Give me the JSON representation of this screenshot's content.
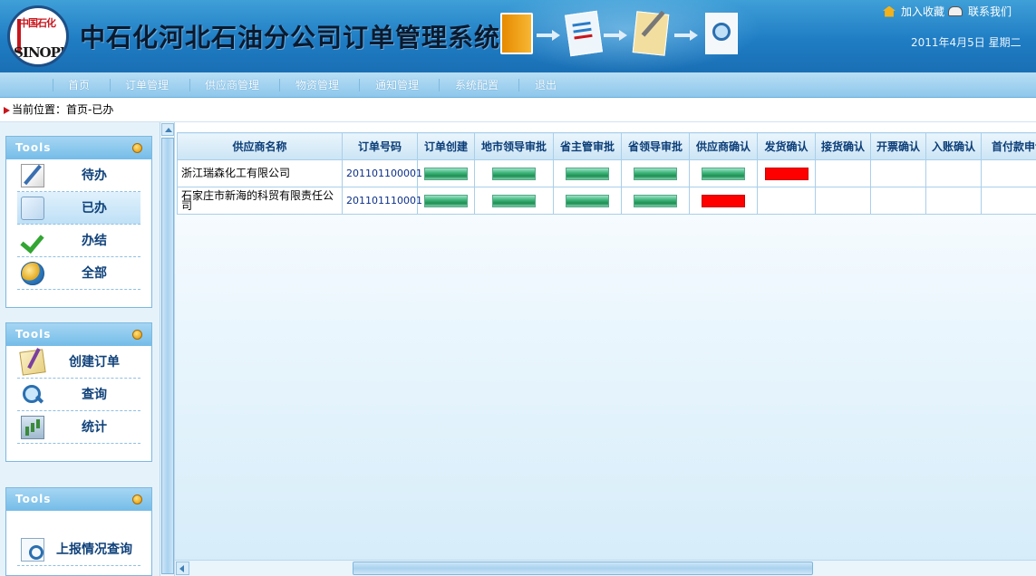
{
  "header": {
    "logo_mark": "中国石化",
    "logo_text": "SINOPEC",
    "system_title": "中石化河北石油分公司订单管理系统",
    "links": {
      "favorite": "加入收藏",
      "contact": "联系我们"
    },
    "date": "2011年4月5日  星期二"
  },
  "nav": {
    "items": [
      "首页",
      "订单管理",
      "供应商管理",
      "物资管理",
      "通知管理",
      "系统配置",
      "退出"
    ]
  },
  "breadcrumb": {
    "text": "当前位置：首页-已办"
  },
  "sidebar": {
    "panels": [
      {
        "title": "Tools",
        "items": [
          {
            "label": "待办",
            "icon": "edit-document-icon"
          },
          {
            "label": "已办",
            "icon": "completed-document-icon",
            "active": true
          },
          {
            "label": "办结",
            "icon": "checkmark-icon"
          },
          {
            "label": "全部",
            "icon": "globe-icon"
          }
        ]
      },
      {
        "title": "Tools",
        "items": [
          {
            "label": "创建订单",
            "icon": "pen-paper-icon"
          },
          {
            "label": "查询",
            "icon": "magnifier-icon"
          },
          {
            "label": "统计",
            "icon": "statistics-icon"
          }
        ]
      },
      {
        "title": "Tools",
        "items": [
          {
            "label": "上报情况查询",
            "icon": "report-search-icon"
          }
        ]
      }
    ]
  },
  "table": {
    "columns": [
      "供应商名称",
      "订单号码",
      "订单创建",
      "地市领导审批",
      "省主管审批",
      "省领导审批",
      "供应商确认",
      "发货确认",
      "接货确认",
      "开票确认",
      "入账确认",
      "首付款申请"
    ],
    "rows": [
      {
        "supplier": "浙江瑞森化工有限公司",
        "order_no": "201101100001",
        "status": [
          "green",
          "green",
          "green",
          "green",
          "green",
          "red",
          "",
          "",
          "",
          ""
        ]
      },
      {
        "supplier": "石家庄市新海的科贸有限责任公司",
        "order_no": "201101110001",
        "status": [
          "green",
          "green",
          "green",
          "green",
          "red",
          "",
          "",
          "",
          "",
          ""
        ]
      }
    ]
  },
  "colors": {
    "header_blue": "#1f7dc4",
    "nav_blue": "#8ec7eb",
    "status_done": "#2e9e65",
    "status_current": "#ff0000",
    "link_text": "#10427a"
  }
}
